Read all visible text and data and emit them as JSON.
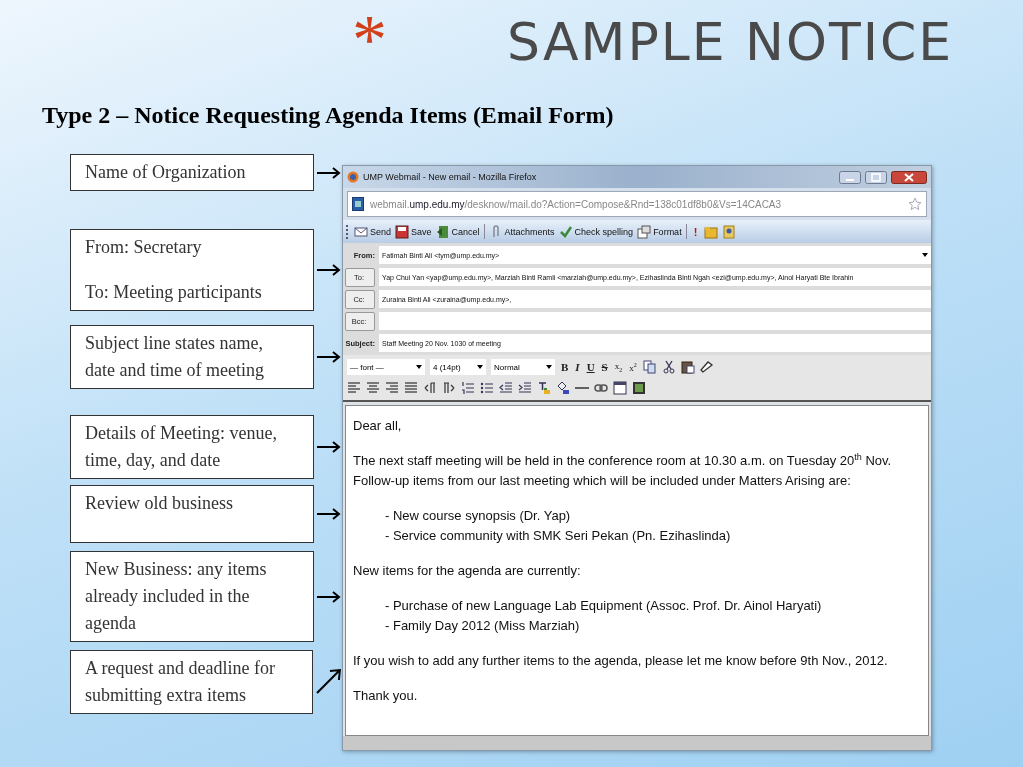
{
  "slide": {
    "bullet": "*",
    "title": "SAMPLE NOTICE",
    "subtitle": "Type 2 – Notice Requesting Agenda Items (Email Form)"
  },
  "callouts": [
    {
      "paragraphs": [
        "Name of Organization"
      ],
      "kind": "right"
    },
    {
      "paragraphs": [
        "From: Secretary",
        "To: Meeting participants"
      ],
      "kind": "right"
    },
    {
      "paragraphs": [
        "Subject line states name, date and time of meeting"
      ],
      "kind": "right"
    },
    {
      "paragraphs": [
        "Details of Meeting: venue, time, day, and date"
      ],
      "kind": "right"
    },
    {
      "paragraphs": [
        "Review old business"
      ],
      "kind": "right"
    },
    {
      "paragraphs": [
        "New Business: any items already included in the agenda"
      ],
      "kind": "right"
    },
    {
      "paragraphs": [
        "A request and deadline for submitting extra items"
      ],
      "kind": "diagonal"
    }
  ],
  "window": {
    "title": "UMP Webmail - New email - Mozilla Firefox",
    "url": "webmail.**ump.edu.my**/desknow/mail.do?Action=Compose&Rnd=138c01df8b0&Vs=14CACA3",
    "toolbar": [
      {
        "kind": "envelope",
        "label": "Send"
      },
      {
        "kind": "disk",
        "label": "Save"
      },
      {
        "kind": "cancel",
        "label": "Cancel"
      },
      {
        "kind": "separator"
      },
      {
        "kind": "paperclip",
        "label": "Attachments"
      },
      {
        "kind": "check",
        "label": "Check spelling"
      },
      {
        "kind": "format",
        "label": "Format"
      },
      {
        "kind": "separator"
      },
      {
        "kind": "text",
        "label": "!"
      },
      {
        "kind": "folder"
      },
      {
        "kind": "contact"
      }
    ],
    "fields": [
      {
        "kind": "select",
        "label": "From:",
        "value": "Fatimah Binti Ali <tym@ump.edu.my>"
      },
      {
        "kind": "button",
        "label": "To:",
        "value": "Yap Chui Yan <yap@ump.edu.my>, Marziah Binti Ramli <marziah@ump.edu.my>, Ezihaslinda Binti Ngah <ezi@ump.edu.my>, Ainol Haryati Bte Ibrahin"
      },
      {
        "kind": "button",
        "label": "Cc:",
        "value": "Zuraina Binti Ali <zuraina@ump.edu.my>,"
      },
      {
        "kind": "button",
        "label": "Bcc:"
      },
      {
        "kind": "text",
        "label": "Subject:",
        "value": "Staff Meeting 20 Nov. 1030 of meeting"
      }
    ],
    "selects": [
      "— font —",
      "4 (14pt)",
      "Normal"
    ],
    "format_row_1": [
      {
        "kind": "bold",
        "label": "B"
      },
      {
        "kind": "italic",
        "label": "I"
      },
      {
        "kind": "underline",
        "label": "U"
      },
      {
        "kind": "strike",
        "label": "S"
      },
      {
        "kind": "subscript",
        "label": "x$_{2}$"
      },
      {
        "kind": "superscript",
        "label": "x$^{2}$"
      },
      {
        "kind": "copy"
      },
      {
        "kind": "cut"
      },
      {
        "kind": "paste"
      },
      {
        "kind": "eraser"
      }
    ],
    "format_row_2": [
      {
        "kind": "align-left"
      },
      {
        "kind": "align-center"
      },
      {
        "kind": "align-right"
      },
      {
        "kind": "justify"
      },
      {
        "kind": "ltr"
      },
      {
        "kind": "rtl"
      },
      {
        "kind": "ordered-list"
      },
      {
        "kind": "bullet-list"
      },
      {
        "kind": "outdent"
      },
      {
        "kind": "indent"
      },
      {
        "kind": "text-color"
      },
      {
        "kind": "fill-color"
      },
      {
        "kind": "rule"
      },
      {
        "kind": "link"
      },
      {
        "kind": "table"
      },
      {
        "kind": "image"
      }
    ],
    "body": [
      {
        "kind": "para",
        "lines": [
          "Dear all,"
        ]
      },
      {
        "kind": "para",
        "lines": [
          "The next staff meeting will be held in the conference room at 10.30 a.m. on Tuesday 20$^{th}$ Nov.",
          "Follow-up items from our last meeting which will be included under Matters Arising are:"
        ]
      },
      {
        "kind": "list",
        "lines": [
          "- New course synopsis (Dr. Yap)",
          "- Service community with SMK Seri Pekan (Pn. Ezihaslinda)"
        ]
      },
      {
        "kind": "para",
        "lines": [
          "New items for the agenda are currently:"
        ]
      },
      {
        "kind": "list",
        "lines": [
          "- Purchase of new Language Lab Equipment (Assoc. Prof. Dr. Ainol Haryati)",
          "- Family Day 2012 (Miss Marziah)"
        ]
      },
      {
        "kind": "para",
        "lines": [
          "If you wish to add any further items to the agenda, please let me know before 9th Nov., 2012."
        ]
      },
      {
        "kind": "para",
        "lines": [
          "Thank you."
        ]
      }
    ]
  }
}
